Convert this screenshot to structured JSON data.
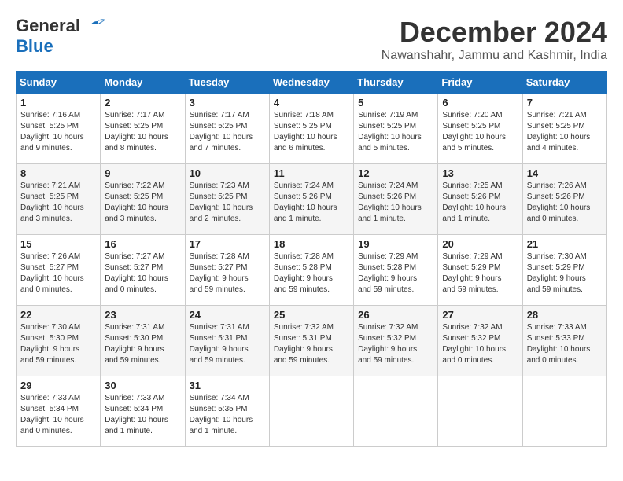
{
  "logo": {
    "line1": "General",
    "line2": "Blue"
  },
  "title": "December 2024",
  "location": "Nawanshahr, Jammu and Kashmir, India",
  "headers": [
    "Sunday",
    "Monday",
    "Tuesday",
    "Wednesday",
    "Thursday",
    "Friday",
    "Saturday"
  ],
  "weeks": [
    [
      {
        "day": "1",
        "info": "Sunrise: 7:16 AM\nSunset: 5:25 PM\nDaylight: 10 hours\nand 9 minutes."
      },
      {
        "day": "2",
        "info": "Sunrise: 7:17 AM\nSunset: 5:25 PM\nDaylight: 10 hours\nand 8 minutes."
      },
      {
        "day": "3",
        "info": "Sunrise: 7:17 AM\nSunset: 5:25 PM\nDaylight: 10 hours\nand 7 minutes."
      },
      {
        "day": "4",
        "info": "Sunrise: 7:18 AM\nSunset: 5:25 PM\nDaylight: 10 hours\nand 6 minutes."
      },
      {
        "day": "5",
        "info": "Sunrise: 7:19 AM\nSunset: 5:25 PM\nDaylight: 10 hours\nand 5 minutes."
      },
      {
        "day": "6",
        "info": "Sunrise: 7:20 AM\nSunset: 5:25 PM\nDaylight: 10 hours\nand 5 minutes."
      },
      {
        "day": "7",
        "info": "Sunrise: 7:21 AM\nSunset: 5:25 PM\nDaylight: 10 hours\nand 4 minutes."
      }
    ],
    [
      {
        "day": "8",
        "info": "Sunrise: 7:21 AM\nSunset: 5:25 PM\nDaylight: 10 hours\nand 3 minutes."
      },
      {
        "day": "9",
        "info": "Sunrise: 7:22 AM\nSunset: 5:25 PM\nDaylight: 10 hours\nand 3 minutes."
      },
      {
        "day": "10",
        "info": "Sunrise: 7:23 AM\nSunset: 5:25 PM\nDaylight: 10 hours\nand 2 minutes."
      },
      {
        "day": "11",
        "info": "Sunrise: 7:24 AM\nSunset: 5:26 PM\nDaylight: 10 hours\nand 1 minute."
      },
      {
        "day": "12",
        "info": "Sunrise: 7:24 AM\nSunset: 5:26 PM\nDaylight: 10 hours\nand 1 minute."
      },
      {
        "day": "13",
        "info": "Sunrise: 7:25 AM\nSunset: 5:26 PM\nDaylight: 10 hours\nand 1 minute."
      },
      {
        "day": "14",
        "info": "Sunrise: 7:26 AM\nSunset: 5:26 PM\nDaylight: 10 hours\nand 0 minutes."
      }
    ],
    [
      {
        "day": "15",
        "info": "Sunrise: 7:26 AM\nSunset: 5:27 PM\nDaylight: 10 hours\nand 0 minutes."
      },
      {
        "day": "16",
        "info": "Sunrise: 7:27 AM\nSunset: 5:27 PM\nDaylight: 10 hours\nand 0 minutes."
      },
      {
        "day": "17",
        "info": "Sunrise: 7:28 AM\nSunset: 5:27 PM\nDaylight: 9 hours\nand 59 minutes."
      },
      {
        "day": "18",
        "info": "Sunrise: 7:28 AM\nSunset: 5:28 PM\nDaylight: 9 hours\nand 59 minutes."
      },
      {
        "day": "19",
        "info": "Sunrise: 7:29 AM\nSunset: 5:28 PM\nDaylight: 9 hours\nand 59 minutes."
      },
      {
        "day": "20",
        "info": "Sunrise: 7:29 AM\nSunset: 5:29 PM\nDaylight: 9 hours\nand 59 minutes."
      },
      {
        "day": "21",
        "info": "Sunrise: 7:30 AM\nSunset: 5:29 PM\nDaylight: 9 hours\nand 59 minutes."
      }
    ],
    [
      {
        "day": "22",
        "info": "Sunrise: 7:30 AM\nSunset: 5:30 PM\nDaylight: 9 hours\nand 59 minutes."
      },
      {
        "day": "23",
        "info": "Sunrise: 7:31 AM\nSunset: 5:30 PM\nDaylight: 9 hours\nand 59 minutes."
      },
      {
        "day": "24",
        "info": "Sunrise: 7:31 AM\nSunset: 5:31 PM\nDaylight: 9 hours\nand 59 minutes."
      },
      {
        "day": "25",
        "info": "Sunrise: 7:32 AM\nSunset: 5:31 PM\nDaylight: 9 hours\nand 59 minutes."
      },
      {
        "day": "26",
        "info": "Sunrise: 7:32 AM\nSunset: 5:32 PM\nDaylight: 9 hours\nand 59 minutes."
      },
      {
        "day": "27",
        "info": "Sunrise: 7:32 AM\nSunset: 5:32 PM\nDaylight: 10 hours\nand 0 minutes."
      },
      {
        "day": "28",
        "info": "Sunrise: 7:33 AM\nSunset: 5:33 PM\nDaylight: 10 hours\nand 0 minutes."
      }
    ],
    [
      {
        "day": "29",
        "info": "Sunrise: 7:33 AM\nSunset: 5:34 PM\nDaylight: 10 hours\nand 0 minutes."
      },
      {
        "day": "30",
        "info": "Sunrise: 7:33 AM\nSunset: 5:34 PM\nDaylight: 10 hours\nand 1 minute."
      },
      {
        "day": "31",
        "info": "Sunrise: 7:34 AM\nSunset: 5:35 PM\nDaylight: 10 hours\nand 1 minute."
      },
      null,
      null,
      null,
      null
    ]
  ]
}
